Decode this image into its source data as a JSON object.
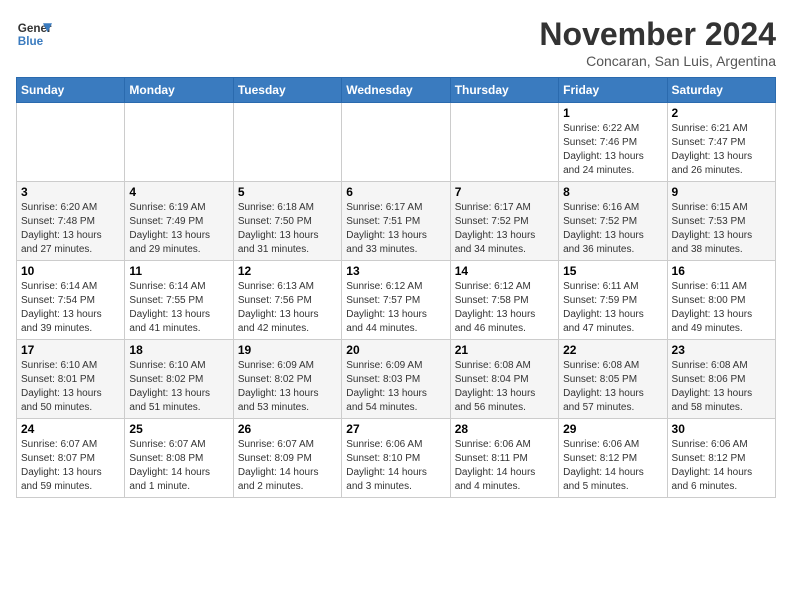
{
  "header": {
    "logo_line1": "General",
    "logo_line2": "Blue",
    "month": "November 2024",
    "location": "Concaran, San Luis, Argentina"
  },
  "weekdays": [
    "Sunday",
    "Monday",
    "Tuesday",
    "Wednesday",
    "Thursday",
    "Friday",
    "Saturday"
  ],
  "weeks": [
    [
      {
        "day": "",
        "info": ""
      },
      {
        "day": "",
        "info": ""
      },
      {
        "day": "",
        "info": ""
      },
      {
        "day": "",
        "info": ""
      },
      {
        "day": "",
        "info": ""
      },
      {
        "day": "1",
        "info": "Sunrise: 6:22 AM\nSunset: 7:46 PM\nDaylight: 13 hours\nand 24 minutes."
      },
      {
        "day": "2",
        "info": "Sunrise: 6:21 AM\nSunset: 7:47 PM\nDaylight: 13 hours\nand 26 minutes."
      }
    ],
    [
      {
        "day": "3",
        "info": "Sunrise: 6:20 AM\nSunset: 7:48 PM\nDaylight: 13 hours\nand 27 minutes."
      },
      {
        "day": "4",
        "info": "Sunrise: 6:19 AM\nSunset: 7:49 PM\nDaylight: 13 hours\nand 29 minutes."
      },
      {
        "day": "5",
        "info": "Sunrise: 6:18 AM\nSunset: 7:50 PM\nDaylight: 13 hours\nand 31 minutes."
      },
      {
        "day": "6",
        "info": "Sunrise: 6:17 AM\nSunset: 7:51 PM\nDaylight: 13 hours\nand 33 minutes."
      },
      {
        "day": "7",
        "info": "Sunrise: 6:17 AM\nSunset: 7:52 PM\nDaylight: 13 hours\nand 34 minutes."
      },
      {
        "day": "8",
        "info": "Sunrise: 6:16 AM\nSunset: 7:52 PM\nDaylight: 13 hours\nand 36 minutes."
      },
      {
        "day": "9",
        "info": "Sunrise: 6:15 AM\nSunset: 7:53 PM\nDaylight: 13 hours\nand 38 minutes."
      }
    ],
    [
      {
        "day": "10",
        "info": "Sunrise: 6:14 AM\nSunset: 7:54 PM\nDaylight: 13 hours\nand 39 minutes."
      },
      {
        "day": "11",
        "info": "Sunrise: 6:14 AM\nSunset: 7:55 PM\nDaylight: 13 hours\nand 41 minutes."
      },
      {
        "day": "12",
        "info": "Sunrise: 6:13 AM\nSunset: 7:56 PM\nDaylight: 13 hours\nand 42 minutes."
      },
      {
        "day": "13",
        "info": "Sunrise: 6:12 AM\nSunset: 7:57 PM\nDaylight: 13 hours\nand 44 minutes."
      },
      {
        "day": "14",
        "info": "Sunrise: 6:12 AM\nSunset: 7:58 PM\nDaylight: 13 hours\nand 46 minutes."
      },
      {
        "day": "15",
        "info": "Sunrise: 6:11 AM\nSunset: 7:59 PM\nDaylight: 13 hours\nand 47 minutes."
      },
      {
        "day": "16",
        "info": "Sunrise: 6:11 AM\nSunset: 8:00 PM\nDaylight: 13 hours\nand 49 minutes."
      }
    ],
    [
      {
        "day": "17",
        "info": "Sunrise: 6:10 AM\nSunset: 8:01 PM\nDaylight: 13 hours\nand 50 minutes."
      },
      {
        "day": "18",
        "info": "Sunrise: 6:10 AM\nSunset: 8:02 PM\nDaylight: 13 hours\nand 51 minutes."
      },
      {
        "day": "19",
        "info": "Sunrise: 6:09 AM\nSunset: 8:02 PM\nDaylight: 13 hours\nand 53 minutes."
      },
      {
        "day": "20",
        "info": "Sunrise: 6:09 AM\nSunset: 8:03 PM\nDaylight: 13 hours\nand 54 minutes."
      },
      {
        "day": "21",
        "info": "Sunrise: 6:08 AM\nSunset: 8:04 PM\nDaylight: 13 hours\nand 56 minutes."
      },
      {
        "day": "22",
        "info": "Sunrise: 6:08 AM\nSunset: 8:05 PM\nDaylight: 13 hours\nand 57 minutes."
      },
      {
        "day": "23",
        "info": "Sunrise: 6:08 AM\nSunset: 8:06 PM\nDaylight: 13 hours\nand 58 minutes."
      }
    ],
    [
      {
        "day": "24",
        "info": "Sunrise: 6:07 AM\nSunset: 8:07 PM\nDaylight: 13 hours\nand 59 minutes."
      },
      {
        "day": "25",
        "info": "Sunrise: 6:07 AM\nSunset: 8:08 PM\nDaylight: 14 hours\nand 1 minute."
      },
      {
        "day": "26",
        "info": "Sunrise: 6:07 AM\nSunset: 8:09 PM\nDaylight: 14 hours\nand 2 minutes."
      },
      {
        "day": "27",
        "info": "Sunrise: 6:06 AM\nSunset: 8:10 PM\nDaylight: 14 hours\nand 3 minutes."
      },
      {
        "day": "28",
        "info": "Sunrise: 6:06 AM\nSunset: 8:11 PM\nDaylight: 14 hours\nand 4 minutes."
      },
      {
        "day": "29",
        "info": "Sunrise: 6:06 AM\nSunset: 8:12 PM\nDaylight: 14 hours\nand 5 minutes."
      },
      {
        "day": "30",
        "info": "Sunrise: 6:06 AM\nSunset: 8:12 PM\nDaylight: 14 hours\nand 6 minutes."
      }
    ]
  ]
}
